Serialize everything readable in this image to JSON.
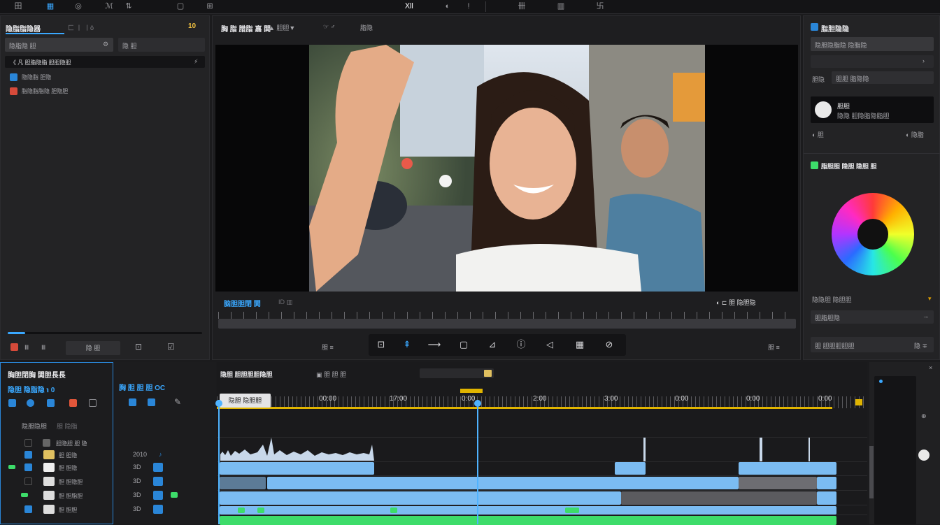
{
  "topbar": {
    "items": [
      "田",
      "▦",
      "◎",
      "ℳ",
      "⇅",
      "▢",
      "⊞",
      "Ⅻ",
      "◐",
      "!",
      "卌",
      "▥",
      "卐"
    ]
  },
  "media_panel": {
    "title": "隐脂脂隐器",
    "tab_extra": "匚 丨 丨ô",
    "counter": "10",
    "search_left": "隐脂隐 胆",
    "search_right": "隐 胆",
    "selected_item": "《 凡 胆脂隐脂 胆胆隐胆",
    "items": [
      {
        "label": "隐隐脂 胆隐"
      },
      {
        "label": "脂隐脂脂隐 胆隐胆"
      }
    ],
    "bottom_buttons": [
      "Ⅲ",
      "隐 胆",
      "⊡",
      "☑"
    ]
  },
  "viewer": {
    "title": "胸 脂 腊脂 嘉 閧",
    "title_extra": "▲ 胆胆▼",
    "title_right": "☞ ♂",
    "title_far": "脂隐",
    "label": "脑胆胆閉 閧",
    "label_extra": "ID ▥",
    "right_controls": "◐ ⊏  胆 隐胆隐",
    "zoom_label": "胆 ≡",
    "tools": [
      "⊡",
      "⇞",
      "⟶",
      "▢",
      "⊿",
      "ⓘ",
      "◁",
      "▦",
      "⊘"
    ]
  },
  "inspector": {
    "title": "脂胆隐隐",
    "field1": "隐胆隐脂隐 隐脂隐",
    "field2_label": "胆隐",
    "field2_value": "胆胆 脂隐隐",
    "card_title": "胆胆",
    "card_sub": "隐隐 胆隐脂隐脂胆",
    "row1_left": "◐ 胆",
    "row1_right": "◐ 隐脂",
    "color_title": "脂胆胆 隐胆 隐胆 胆",
    "field3": "隐隐胆 隐胆胆",
    "field4": "胆脂胆隐",
    "field5": "胆 胆胆胆胆胆",
    "field5_right": "隐 ∓"
  },
  "timeline_left": {
    "title": "胸胆閉胸 閧胆長長",
    "subtitle": "隐胆 隐脂隐 ℩ 0",
    "header_label": "隐胆隐胆",
    "header_extra": "胆 隐脂",
    "col2_title": "胸 胆 胆 胆 ОС",
    "track_names": [
      "胆隐胆 胆 隐",
      "胆 胆隐",
      "胆 胆隐",
      "胆 胆隐胆",
      "胆 胆脂胆",
      "胆 胆胆"
    ],
    "track_nums": [
      "2010",
      "3D",
      "3D",
      "3D",
      "3D"
    ]
  },
  "timeline": {
    "title": "隐胆 胆胆胆胆隐胆",
    "title_extra": "▣  胆 胆 胆",
    "clip_label": "隐胆 隐胆胆",
    "ruler": [
      "00:00",
      "17:00",
      "0:00",
      "2:00",
      "3:00",
      "0:00",
      "0:00",
      "0:00"
    ]
  },
  "colors": {
    "accent": "#3aa8ff",
    "clip_blue": "#7bbcf2",
    "clip_green": "#3ddc6a",
    "playhead": "#4fb3ff",
    "gold": "#e0b400"
  }
}
